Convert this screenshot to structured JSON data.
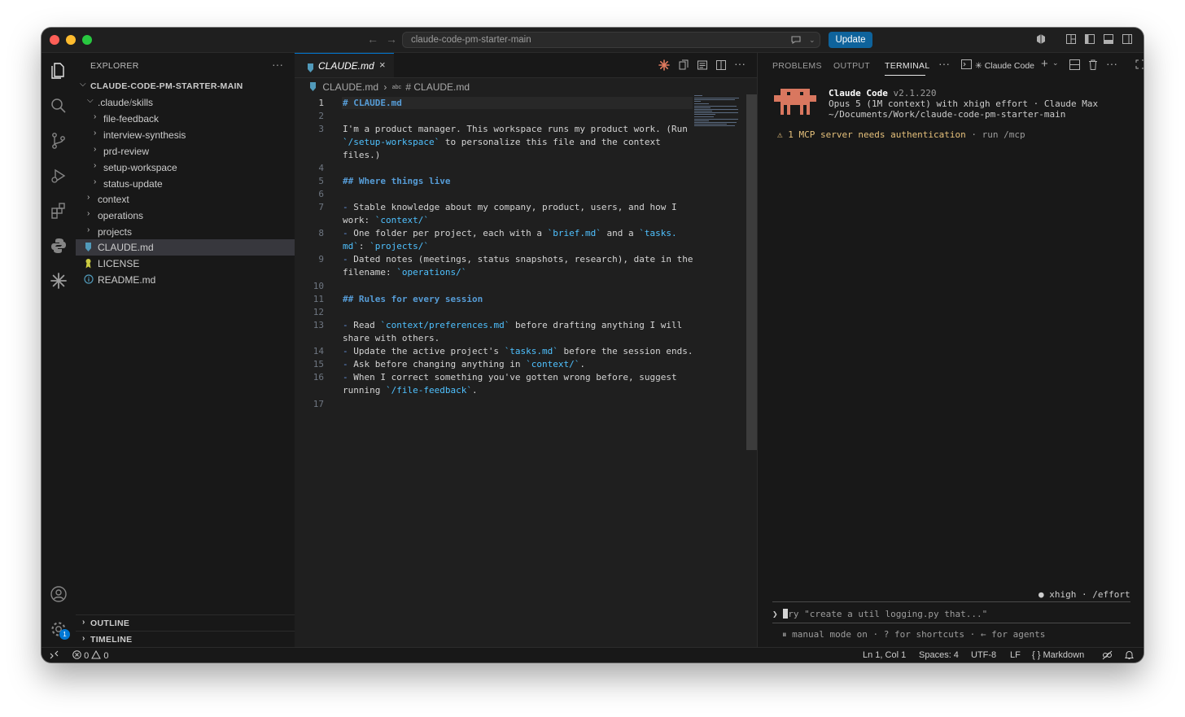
{
  "titlebar": {
    "search_text": "claude-code-pm-starter-main",
    "update_label": "Update",
    "colors": {
      "red": "#ff5f57",
      "yellow": "#febc2e",
      "green": "#28c840"
    }
  },
  "sidebar": {
    "header": "EXPLORER",
    "more": "···",
    "root": "CLAUDE-CODE-PM-STARTER-MAIN",
    "folder_claude": ".claude",
    "folder_claude_sep": "/",
    "folder_skills": "skills",
    "skills": [
      "file-feedback",
      "interview-synthesis",
      "prd-review",
      "setup-workspace",
      "status-update"
    ],
    "folders": [
      "context",
      "operations",
      "projects"
    ],
    "files": [
      "CLAUDE.md",
      "LICENSE",
      "README.md"
    ],
    "outline": "OUTLINE",
    "timeline": "TIMELINE",
    "settings_badge": "1"
  },
  "editor": {
    "tab_label": "CLAUDE.md",
    "tab_close": "×",
    "breadcrumb_file": "CLAUDE.md",
    "breadcrumb_sep": "›",
    "breadcrumb_symbol_prefix": "abc",
    "breadcrumb_symbol": "# CLAUDE.md",
    "line_numbers": [
      "1",
      "2",
      "3",
      "4",
      "5",
      "6",
      "7",
      "8",
      "9",
      "10",
      "11",
      "12",
      "13",
      "14",
      "15",
      "16",
      "17"
    ],
    "l1": "# CLAUDE.md",
    "l3a": "I'm a product manager. This workspace runs my product work. (Run",
    "l3b_code": "`/setup-workspace`",
    "l3b_rest": " to personalize this file and the context",
    "l3c": "files.)",
    "l5": "## Where things live",
    "bullet": "- ",
    "l7a": "Stable knowledge about my company, product, users, and how I",
    "l7b_pre": "work: ",
    "l7b_code": "`context/`",
    "l8a_pre": "One folder per project, each with a ",
    "l8a_code1": "`brief.md`",
    "l8a_mid": " and a ",
    "l8a_code2": "`tasks.",
    "l8b_code1": "md`",
    "l8b_mid": ": ",
    "l8b_code2": "`projects/`",
    "l9a": "Dated notes (meetings, status snapshots, research), date in the",
    "l9b_pre": "filename: ",
    "l9b_code": "`operations/`",
    "l11": "## Rules for every session",
    "l13a_pre": "Read ",
    "l13a_code": "`context/preferences.md`",
    "l13a_rest": " before drafting anything I will",
    "l13b": "share with others.",
    "l14_pre": "Update the active project's ",
    "l14_code": "`tasks.md`",
    "l14_rest": " before the session ends.",
    "l15_pre": "Ask before changing anything in ",
    "l15_code": "`context/`",
    "l15_rest": ".",
    "l16a": "When I correct something you've gotten wrong before, suggest",
    "l16b_pre": "running ",
    "l16b_code": "`/file-feedback`",
    "l16b_rest": "."
  },
  "panel": {
    "tabs": [
      "PROBLEMS",
      "OUTPUT",
      "TERMINAL"
    ],
    "more": "···",
    "terminal_name": "✳ Claude Code",
    "app_name": "Claude Code",
    "version": " v2.1.220",
    "model_line": "Opus 5 (1M context) with xhigh effort · Claude Max",
    "path_line": "~/Documents/Work/claude-code-pm-starter-main",
    "warning": "⚠ 1 MCP server needs authentication",
    "warning_hint": " · run /mcp",
    "effort": "● xhigh · /effort",
    "prompt_symbol": "❯",
    "prompt_placeholder": "ry \"create a util logging.py that...\"",
    "mode_line": "⏸ manual mode on · ? for shortcuts · ← for agents"
  },
  "statusbar": {
    "errors": "0",
    "warnings": "0",
    "position": "Ln 1, Col 1",
    "spaces": "Spaces: 4",
    "encoding": "UTF-8",
    "eol": "LF",
    "language": "Markdown"
  }
}
